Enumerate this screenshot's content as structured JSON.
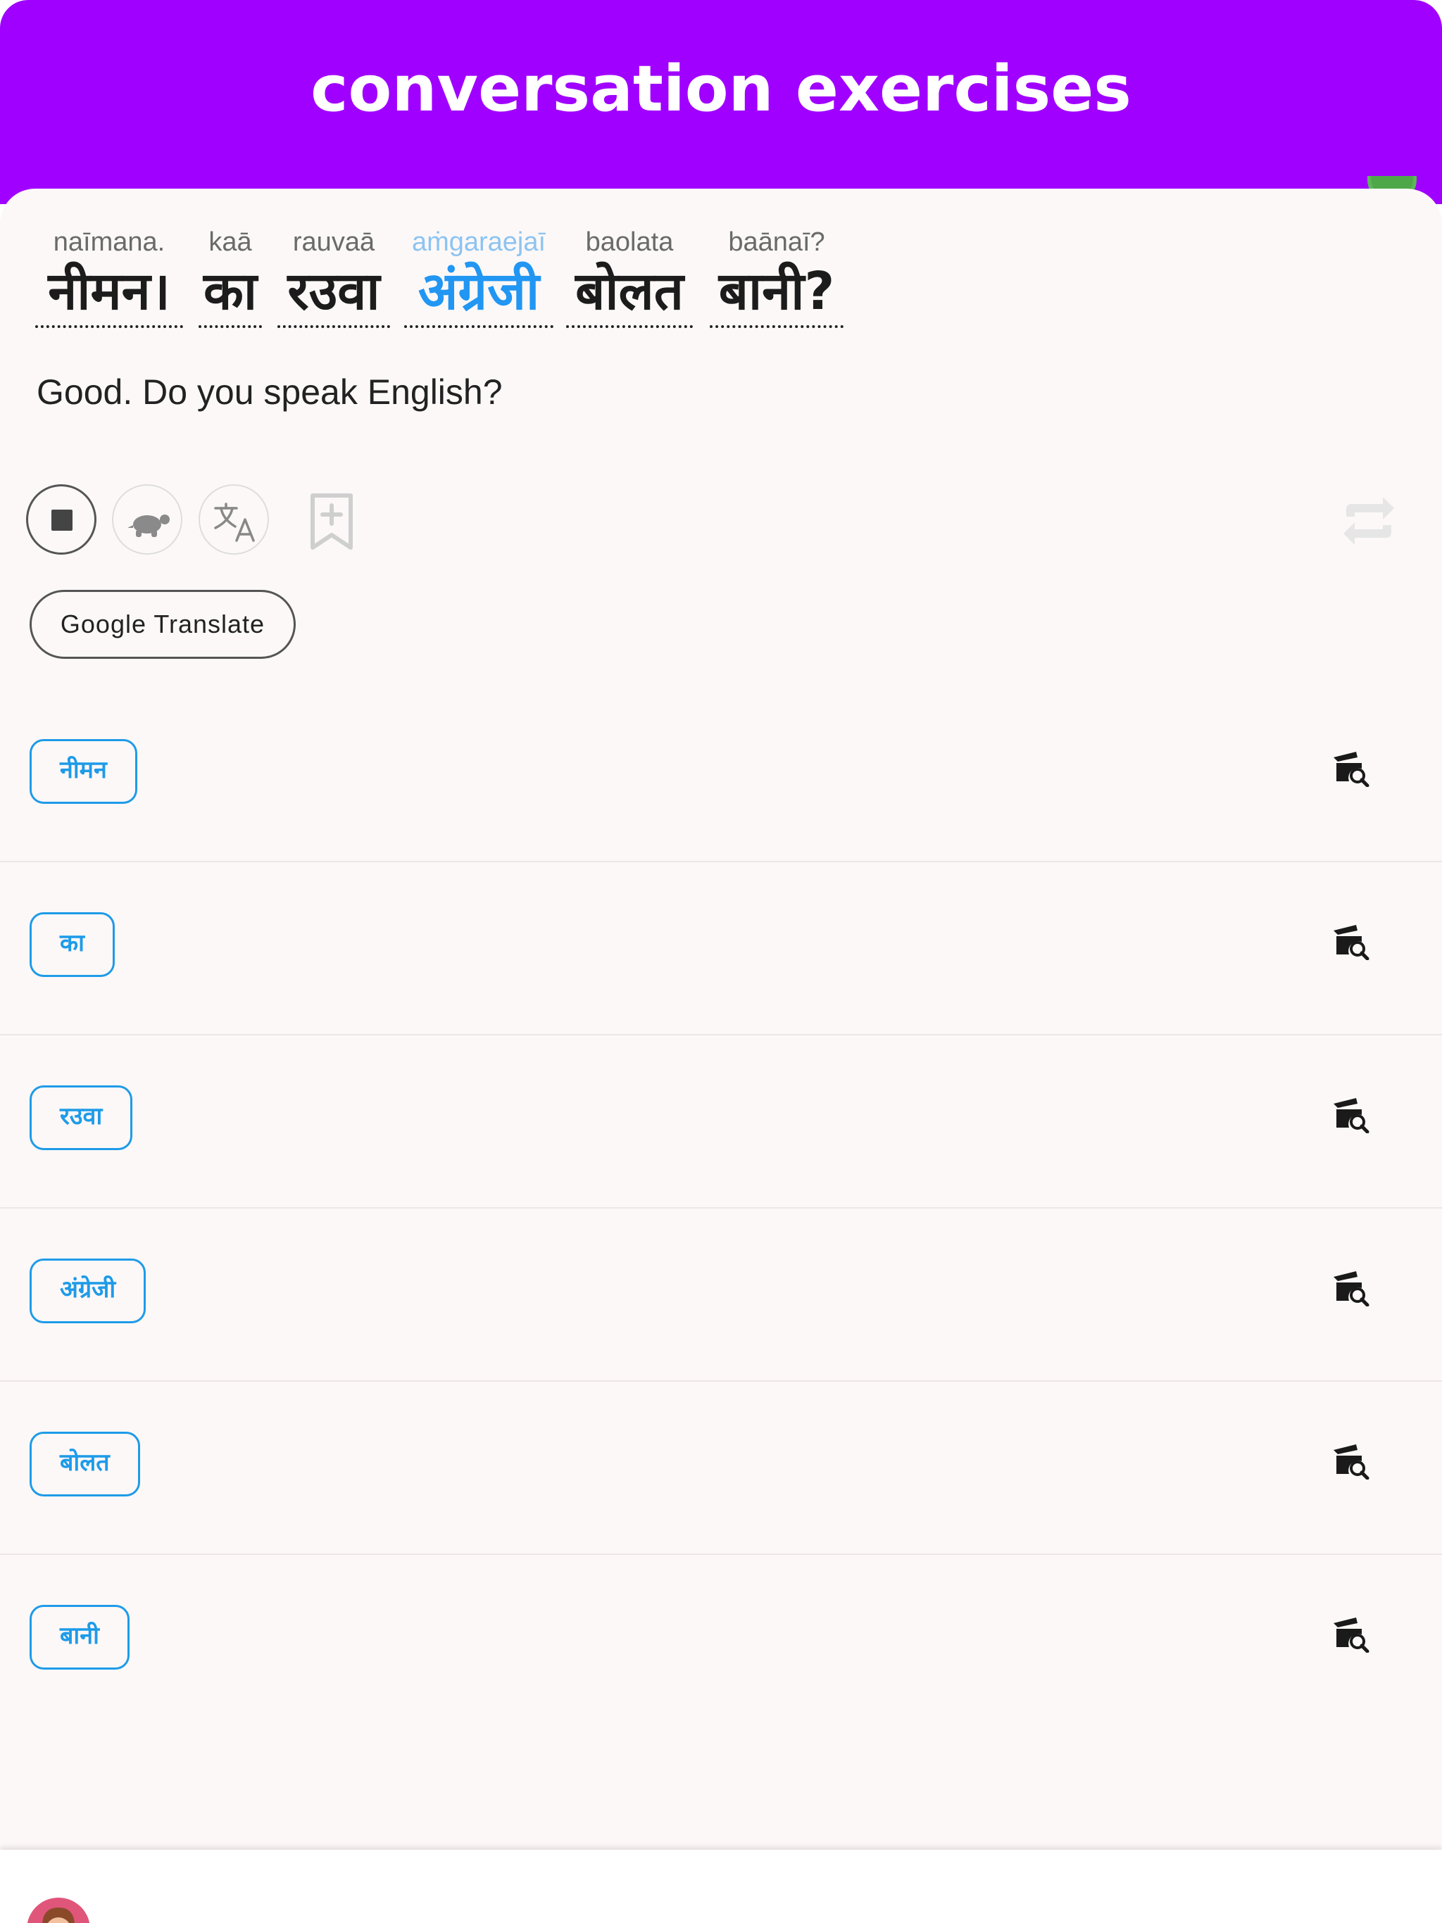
{
  "header": {
    "title": "conversation exercises"
  },
  "sentence": {
    "words": [
      {
        "translit": "naīmana.",
        "text": "नीमन।",
        "highlight": false
      },
      {
        "translit": "kaā",
        "text": "का",
        "highlight": false
      },
      {
        "translit": "rauvaā",
        "text": "रउवा",
        "highlight": false
      },
      {
        "translit": "aṁgaraejaī",
        "text": "अंग्रेजी",
        "highlight": true
      },
      {
        "translit": "baolata",
        "text": "बोलत",
        "highlight": false
      },
      {
        "translit": "baānaī?",
        "text": "बानी?",
        "highlight": false
      }
    ],
    "translation": "Good. Do you speak English?"
  },
  "controls": {
    "stop_icon": "stop-icon",
    "slow_icon": "turtle-icon",
    "translate_icon": "translate-icon",
    "bookmark_icon": "bookmark-add-icon",
    "repeat_icon": "repeat-icon",
    "google_translate_label": "Google Translate"
  },
  "word_list": [
    {
      "word": "नीमन",
      "icon": "video-search-icon"
    },
    {
      "word": "का",
      "icon": "video-search-icon"
    },
    {
      "word": "रउवा",
      "icon": "video-search-icon"
    },
    {
      "word": "अंग्रेजी",
      "icon": "video-search-icon"
    },
    {
      "word": "बोलत",
      "icon": "video-search-icon"
    },
    {
      "word": "बानी",
      "icon": "video-search-icon"
    }
  ],
  "colors": {
    "header": "#a000ff",
    "accent_blue": "#1e9be8",
    "highlight_blue": "#2196f3",
    "background": "#fdf8f8"
  }
}
